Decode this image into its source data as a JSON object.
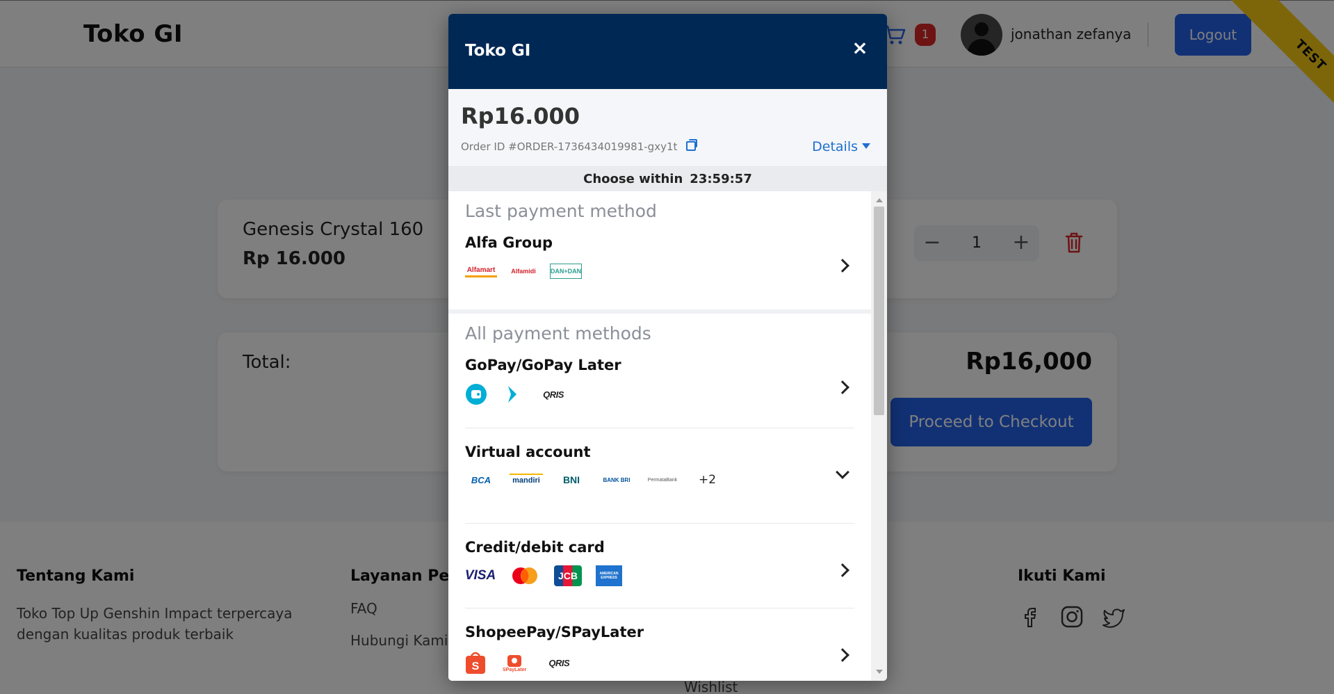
{
  "header": {
    "brand": "Toko GI",
    "cart_count": "1",
    "username": "jonathan zefanya",
    "logout_label": "Logout",
    "ribbon_label": "TEST"
  },
  "cart": {
    "item_name": "Genesis Crystal 160",
    "item_price": "Rp 16.000",
    "qty_minus": "−",
    "qty_value": "1",
    "qty_plus": "+",
    "total_label": "Total:",
    "total_value": "Rp16,000",
    "checkout_label": "Proceed to Checkout"
  },
  "footer": {
    "about_title": "Tentang Kami",
    "about_text": "Toko Top Up Genshin Impact terpercaya dengan kualitas produk terbaik",
    "service_title": "Layanan Pela",
    "service_links": [
      "FAQ",
      "Hubungi Kami"
    ],
    "wishlist": "Wishlist",
    "follow_title": "Ikuti Kami"
  },
  "modal": {
    "title": "Toko GI",
    "close": "×",
    "amount": "Rp16.000",
    "order_id": "Order ID #ORDER-1736434019981-gxy1t",
    "details_label": "Details",
    "timer_label": "Choose within",
    "timer_value": "23:59:57",
    "last_section_title": "Last payment method",
    "all_section_title": "All payment methods",
    "last_method": {
      "name": "Alfa Group",
      "logos": [
        "Alfamart",
        "Alfamidi",
        "DAN+DAN"
      ]
    },
    "methods": [
      {
        "name": "GoPay/GoPay Later",
        "logos": [
          "gopay-icon",
          "gopaylater-icon",
          "QRIS"
        ],
        "chevron": "right"
      },
      {
        "name": "Virtual account",
        "logos": [
          "BCA",
          "mandiri",
          "BNI",
          "BANK BRI",
          "PermataBank"
        ],
        "extra": "+2",
        "chevron": "down"
      },
      {
        "name": "Credit/debit card",
        "logos": [
          "VISA",
          "mastercard-icon",
          "JCB",
          "AMERICAN EXPRESS"
        ],
        "chevron": "right"
      },
      {
        "name": "ShopeePay/SPayLater",
        "logos": [
          "shopeepay-icon",
          "SPayLater",
          "QRIS"
        ],
        "chevron": "right"
      }
    ]
  },
  "colors": {
    "modal_header": "#002855",
    "accent_blue": "#2563eb",
    "link_blue": "#1d6fd1",
    "badge_red": "#dc2626",
    "ribbon_yellow": "#facc15"
  }
}
